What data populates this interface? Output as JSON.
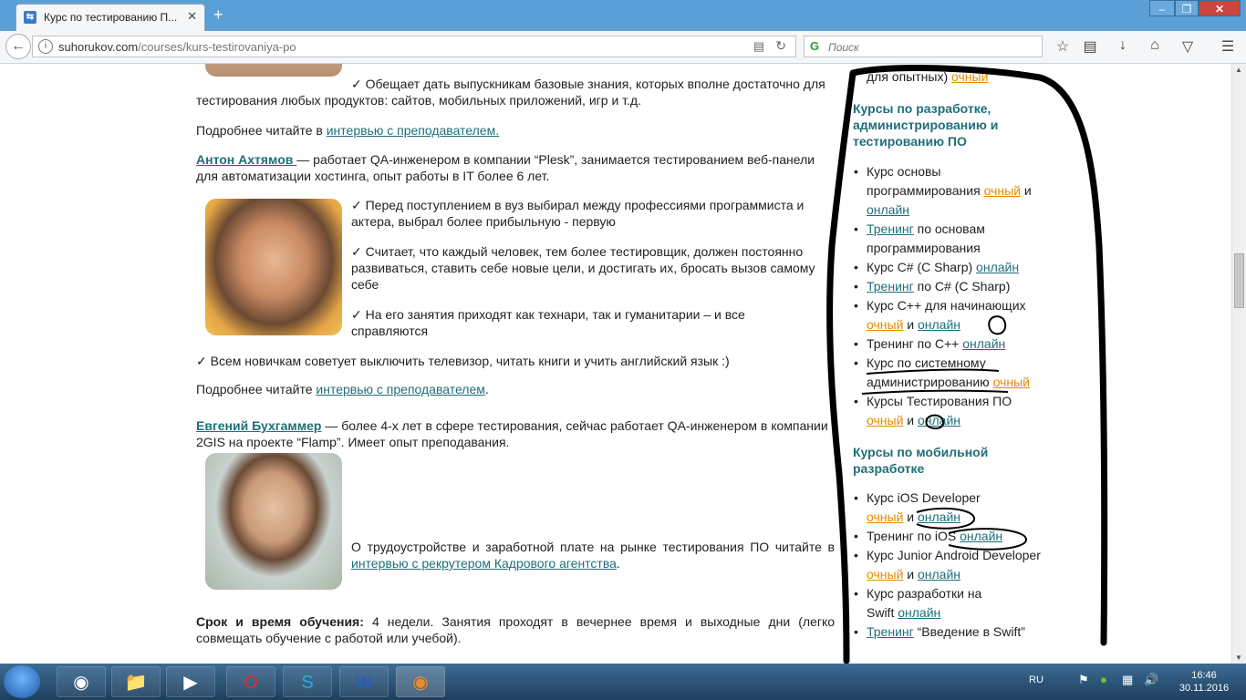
{
  "browser": {
    "tab_title": "Курс по тестированию П...",
    "tab_close": "✕",
    "new_tab": "+",
    "url_domain": "suhorukov.com",
    "url_path": "/courses/kurs-testirovaniya-po",
    "search_placeholder": "Поиск"
  },
  "content": {
    "p1": "✓ Обещает дать выпускникам базовые знания, которых вполне достаточно для тестирования любых продуктов: сайтов, мобильных приложений, игр и т.д.",
    "p2_prefix": "Подробнее читайте в ",
    "p2_link": "интервью с преподавателем.",
    "anton_name": "Антон Ахтямов ",
    "anton_desc": " — работает QA-инженером в компании “Plesk”, занимается тестированием веб-панели для автоматизации хостинга, опыт работы в IT более 6 лет.",
    "anton_b1": "✓ Перед поступлением в вуз выбирал между профессиями программиста и актера, выбрал более прибыльную - первую",
    "anton_b2": "✓ Считает, что каждый человек, тем более тестировщик, должен постоянно  развиваться, ставить себе новые цели, и достигать их, бросать вызов самому себе",
    "anton_b3": "✓ На его занятия приходят как технари, так и гуманитарии – и все справляются",
    "anton_b4": "✓ Всем новичкам советует выключить телевизор, читать книги и учить английский язык :)",
    "p3_prefix": "Подробнее читайте ",
    "p3_link": "интервью с преподавателем",
    "p3_suffix": ".",
    "evgeny_name": "Евгений Бухгаммер",
    "evgeny_desc": " — более 4-х лет в сфере тестирования, сейчас работает QA-инженером в компании 2GIS на проекте “Flamp”. Имеет опыт преподавания.",
    "salary_prefix": "О трудоустройстве и заработной плате на рынке тестирования ПО читайте в ",
    "salary_link": "интервью с рекрутером Кадрового агентства",
    "salary_suffix": ".",
    "term_label": "Срок и время обучения:",
    "term_text": " 4 недели. Занятия проходят в вечернее время и выходные дни (легко совмещать обучение с работой или учебой)."
  },
  "sidebar": {
    "top_text": "для опытных) ",
    "top_link": "очный",
    "h1": "Курсы по разработке, администрированию и тестированию ПО",
    "h2": "Курсы по мобильной разработке",
    "ochny": "очный",
    "online": "онлайн",
    "and": " и ",
    "i1a": "Курс основы программирования ",
    "i2_link": "Тренинг",
    "i2b": " по основам программирования",
    "i3a": "Курс C# (C Sharp) ",
    "i4b": " по C# (C Sharp)",
    "i5a": "Курс C++ для начинающих ",
    "i6a": "Тренинг по C++ ",
    "i7a": "Курс по системному администрированию ",
    "i8a": "Курсы Тестирования ПО ",
    "m1a": "Курс iOS Developer",
    "m2a": "Тренинг по iOS ",
    "m3a": "Курс Junior Android Developer",
    "m4a": "Курс разработки на Swift ",
    "m5b": " “Введение в Swift”",
    "bullet": "•"
  },
  "taskbar": {
    "lang": "RU",
    "time": "16:46",
    "date": "30.11.2016"
  }
}
